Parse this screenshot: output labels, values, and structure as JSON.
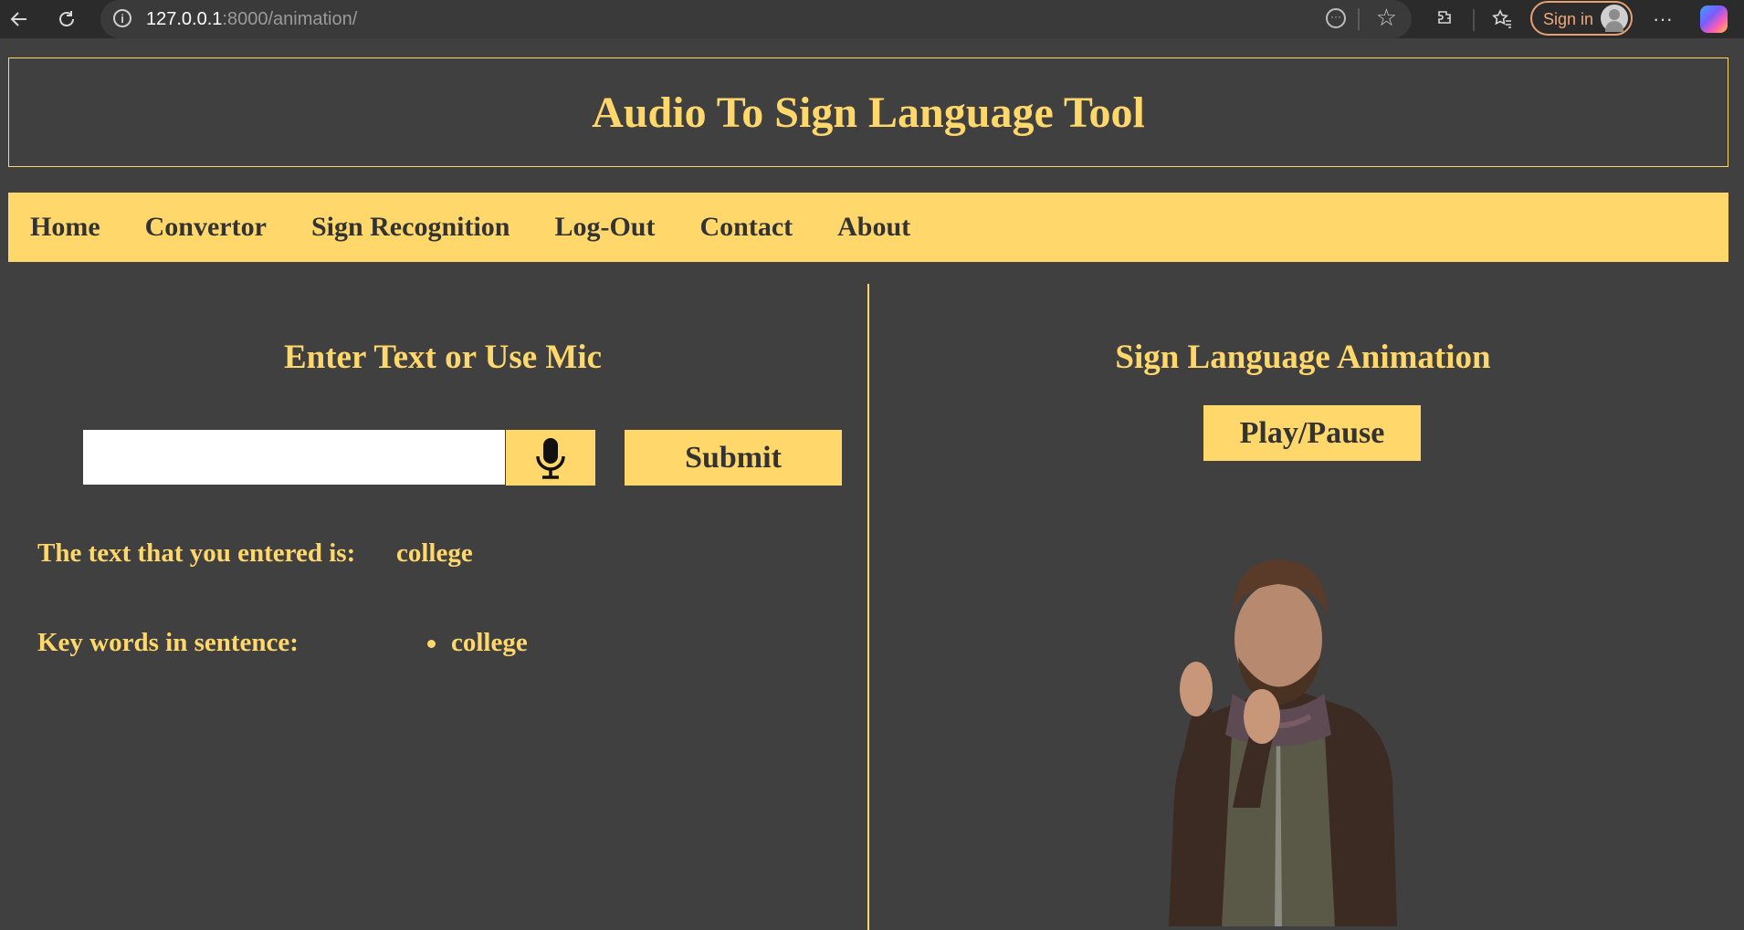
{
  "browser": {
    "url_host": "127.0.0.1",
    "url_rest": ":8000/animation/",
    "signin_label": "Sign in"
  },
  "header": {
    "title": "Audio To Sign Language Tool"
  },
  "nav": {
    "items": [
      "Home",
      "Convertor",
      "Sign Recognition",
      "Log-Out",
      "Contact",
      "About"
    ]
  },
  "left": {
    "title": "Enter Text or Use Mic",
    "input_value": "",
    "submit_label": "Submit",
    "entered_label": "The text that you entered is:",
    "entered_value": "college",
    "keywords_label": "Key words in sentence:",
    "keywords": [
      "college"
    ]
  },
  "right": {
    "title": "Sign Language Animation",
    "play_label": "Play/Pause"
  },
  "colors": {
    "accent": "#ffd76a",
    "background": "#404040",
    "nav_text": "#333333"
  }
}
